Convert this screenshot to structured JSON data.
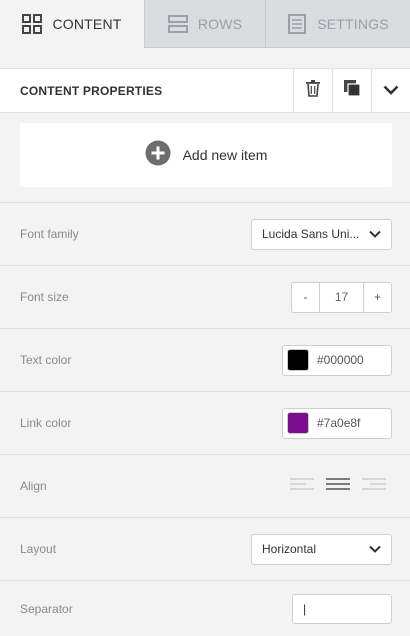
{
  "tabs": [
    {
      "label": "CONTENT",
      "icon": "content-grid-icon",
      "active": true
    },
    {
      "label": "ROWS",
      "icon": "rows-icon",
      "active": false
    },
    {
      "label": "SETTINGS",
      "icon": "settings-doc-icon",
      "active": false
    }
  ],
  "header": {
    "title": "CONTENT PROPERTIES",
    "actions": [
      "trash-icon",
      "duplicate-icon",
      "collapse-chevron-icon"
    ]
  },
  "add_item": {
    "label": "Add new item",
    "icon": "plus-circle-icon"
  },
  "properties": {
    "font_family": {
      "label": "Font family",
      "value": "Lucida Sans Uni..."
    },
    "font_size": {
      "label": "Font size",
      "value": "17",
      "decrement": "-",
      "increment": "+"
    },
    "text_color": {
      "label": "Text color",
      "value": "#000000",
      "swatch": "#000000"
    },
    "link_color": {
      "label": "Link color",
      "value": "#7a0e8f",
      "swatch": "#7a0e8f"
    },
    "align": {
      "label": "Align",
      "options": [
        "align-left-icon",
        "align-center-icon",
        "align-right-icon"
      ],
      "selected": "center"
    },
    "layout": {
      "label": "Layout",
      "value": "Horizontal"
    },
    "separator": {
      "label": "Separator",
      "value": "|"
    }
  },
  "colors": {
    "accent_text": "#333333",
    "label_text": "#8a8a8a",
    "tab_inactive": "#9aa0a6"
  }
}
